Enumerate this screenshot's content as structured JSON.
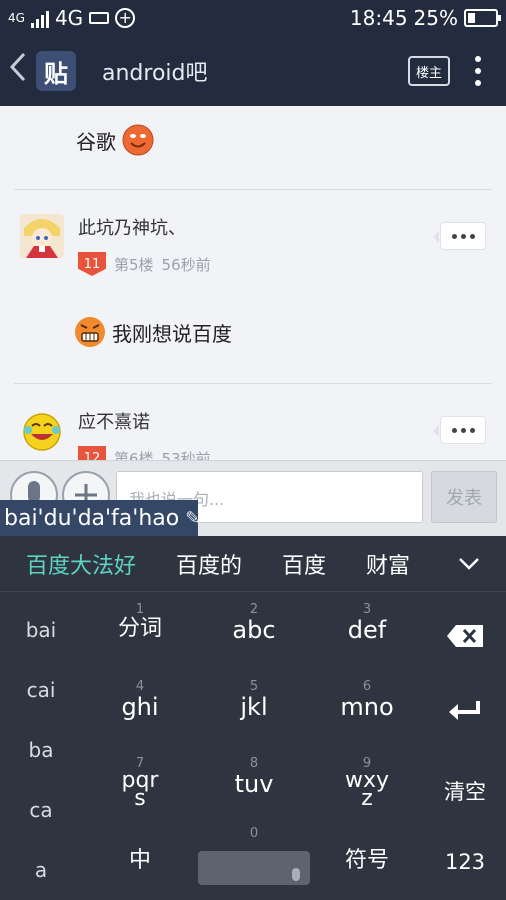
{
  "status_bar": {
    "sim_label": "4G",
    "network": "4G",
    "time": "18:45",
    "battery_percent": "25%",
    "battery_level": 0.25
  },
  "header": {
    "logo_text": "贴",
    "title": "android吧",
    "owner_button": "楼主"
  },
  "posts": [
    {
      "text": "谷歌",
      "emoji": "smile-emoticon"
    },
    {
      "username": "此坑乃神坑、",
      "level": "11",
      "floor": "第5楼",
      "time": "56秒前",
      "text": "我刚想说百度",
      "emoji": "grin-emoticon"
    },
    {
      "username": "应不熹诺",
      "level": "12",
      "floor": "第6楼",
      "time": "53秒前"
    }
  ],
  "composer": {
    "placeholder": "我也说一句...",
    "send_label": "发表",
    "pinyin": "bai'du'da'fa'hao"
  },
  "ime": {
    "candidates": [
      "百度大法好",
      "百度的",
      "百度",
      "财富"
    ],
    "pinyin_suggestions": [
      "bai",
      "cai",
      "ba",
      "ca",
      "a"
    ],
    "keys": [
      {
        "num": "1",
        "label": "分词"
      },
      {
        "num": "2",
        "label": "abc"
      },
      {
        "num": "3",
        "label": "def"
      },
      {
        "num": "4",
        "label": "ghi"
      },
      {
        "num": "5",
        "label": "jkl"
      },
      {
        "num": "6",
        "label": "mno"
      },
      {
        "num": "7",
        "label_top": "pqr",
        "label_bottom": "s"
      },
      {
        "num": "8",
        "label": "tuv"
      },
      {
        "num": "9",
        "label_top": "wxy",
        "label_bottom": "z"
      }
    ],
    "clear_label": "清空",
    "chinese_label": "中",
    "space_num": "0",
    "symbol_label": "符号",
    "numeric_label": "123"
  },
  "colors": {
    "header_bg": "#232c3e",
    "ime_bg": "#2f3540",
    "candidate_highlight": "#5fd3c1",
    "level_badge": "#e7543b"
  }
}
